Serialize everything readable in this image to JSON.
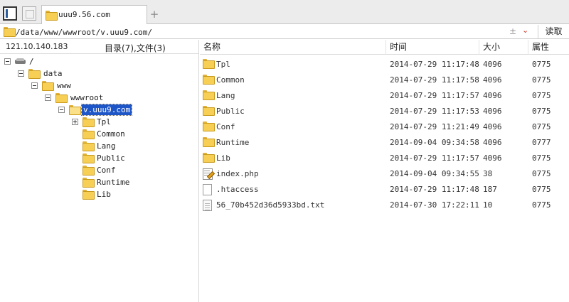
{
  "tabs": {
    "active_label": "uuu9.56.com",
    "add_label": "+"
  },
  "address": {
    "path": "/data/www/wwwroot/v.uuu9.com/",
    "read_label": "读取"
  },
  "left_panel": {
    "host": "121.10.140.183",
    "counts": "目录(7),文件(3)",
    "tree": [
      {
        "label": "/"
      },
      {
        "label": "data"
      },
      {
        "label": "www"
      },
      {
        "label": "wwwroot"
      },
      {
        "label": "v.uuu9.com"
      },
      {
        "label": "Tpl"
      },
      {
        "label": "Common"
      },
      {
        "label": "Lang"
      },
      {
        "label": "Public"
      },
      {
        "label": "Conf"
      },
      {
        "label": "Runtime"
      },
      {
        "label": "Lib"
      }
    ]
  },
  "file_list": {
    "columns": {
      "name": "名称",
      "time": "时间",
      "size": "大小",
      "attr": "属性"
    },
    "rows": [
      {
        "icon": "folder-icon",
        "name": "Tpl",
        "time": "2014-07-29 11:17:48",
        "size": "4096",
        "attr": "0775"
      },
      {
        "icon": "folder-icon",
        "name": "Common",
        "time": "2014-07-29 11:17:58",
        "size": "4096",
        "attr": "0775"
      },
      {
        "icon": "folder-icon",
        "name": "Lang",
        "time": "2014-07-29 11:17:57",
        "size": "4096",
        "attr": "0775"
      },
      {
        "icon": "folder-icon",
        "name": "Public",
        "time": "2014-07-29 11:17:53",
        "size": "4096",
        "attr": "0775"
      },
      {
        "icon": "folder-icon",
        "name": "Conf",
        "time": "2014-07-29 11:21:49",
        "size": "4096",
        "attr": "0775"
      },
      {
        "icon": "folder-icon",
        "name": "Runtime",
        "time": "2014-09-04 09:34:58",
        "size": "4096",
        "attr": "0777"
      },
      {
        "icon": "folder-icon",
        "name": "Lib",
        "time": "2014-07-29 11:17:57",
        "size": "4096",
        "attr": "0775"
      },
      {
        "icon": "php-file-icon",
        "name": "index.php",
        "time": "2014-09-04 09:34:55",
        "size": "38",
        "attr": "0775"
      },
      {
        "icon": "file-icon",
        "name": ".htaccess",
        "time": "2014-07-29 11:17:48",
        "size": "187",
        "attr": "0775"
      },
      {
        "icon": "text-file-icon",
        "name": "56_70b452d36d5933bd.txt",
        "time": "2014-07-30 17:22:11",
        "size": "10",
        "attr": "0775"
      }
    ]
  }
}
